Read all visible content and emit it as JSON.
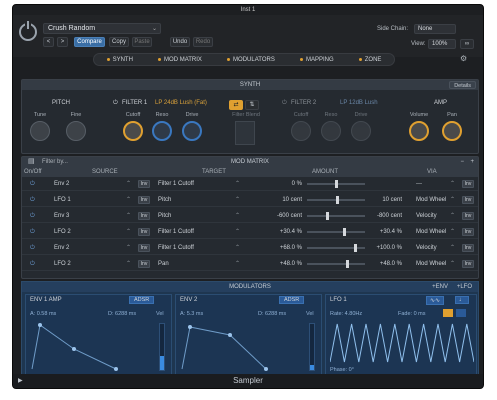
{
  "window": {
    "title": "Inst 1",
    "footer": "Sampler"
  },
  "top": {
    "preset": "Crush Random",
    "compare": "Compare",
    "copy": "Copy",
    "paste": "Paste",
    "undo": "Undo",
    "redo": "Redo",
    "sidechain_label": "Side Chain:",
    "sidechain_value": "None",
    "view_label": "View:",
    "view_value": "100%"
  },
  "tabs": [
    "SYNTH",
    "MOD MATRIX",
    "MODULATORS",
    "MAPPING",
    "ZONE"
  ],
  "synth": {
    "header": "SYNTH",
    "details": "Details",
    "pitch": {
      "title": "PITCH",
      "tune": "Tune",
      "fine": "Fine"
    },
    "filter1": {
      "title": "FILTER 1",
      "type": "LP 24dB Lush (Fat)",
      "cutoff": "Cutoff",
      "reso": "Reso",
      "drive": "Drive"
    },
    "blend": {
      "label": "Filter Blend"
    },
    "filter2": {
      "title": "FILTER 2",
      "type": "LP 12dB Lush",
      "cutoff": "Cutoff",
      "reso": "Reso",
      "drive": "Drive"
    },
    "amp": {
      "title": "AMP",
      "volume": "Volume",
      "pan": "Pan"
    }
  },
  "modmatrix": {
    "header": "MOD MATRIX",
    "filter": "Filter by...",
    "cols": {
      "onoff": "On/Off",
      "source": "SOURCE",
      "target": "TARGET",
      "amount": "AMOUNT",
      "via": "VIA"
    },
    "rows": [
      {
        "source": "Env 2",
        "target": "Filter 1 Cutoff",
        "amount": "0 %",
        "amount2": "",
        "via": "---",
        "pos": 0.5
      },
      {
        "source": "LFO 1",
        "target": "Pitch",
        "amount": "10 cent",
        "amount2": "10 cent",
        "via": "Mod Wheel",
        "pos": 0.52
      },
      {
        "source": "Env 3",
        "target": "Pitch",
        "amount": "-600 cent",
        "amount2": "-800 cent",
        "via": "Velocity",
        "pos": 0.35
      },
      {
        "source": "LFO 2",
        "target": "Filter 1 Cutoff",
        "amount": "+30.4 %",
        "amount2": "+30.4 %",
        "via": "Mod Wheel",
        "pos": 0.65
      },
      {
        "source": "Env 2",
        "target": "Filter 1 Cutoff",
        "amount": "+68.0 %",
        "amount2": "+100.0 %",
        "via": "Velocity",
        "pos": 0.85
      },
      {
        "source": "LFO 2",
        "target": "Pan",
        "amount": "+48.0 %",
        "amount2": "+48.0 %",
        "via": "Mod Wheel",
        "pos": 0.7
      }
    ]
  },
  "modulators": {
    "header": "MODULATORS",
    "env_btn": "ENV",
    "lfo_btn": "LFO",
    "env1": {
      "title": "ENV 1 AMP",
      "mode": "ADSR",
      "a": "A: 0.58 ms",
      "d": "D: 6288 ms",
      "vel": "Vel"
    },
    "env2": {
      "title": "ENV 2",
      "mode": "ADSR",
      "a": "A: 5.3 ms",
      "d": "D: 6288 ms",
      "vel": "Vel"
    },
    "lfo1": {
      "title": "LFO 1",
      "rate": "Rate: 4.80Hz",
      "fade": "Fade: 0 ms",
      "phase": "Phase: 0°"
    }
  }
}
